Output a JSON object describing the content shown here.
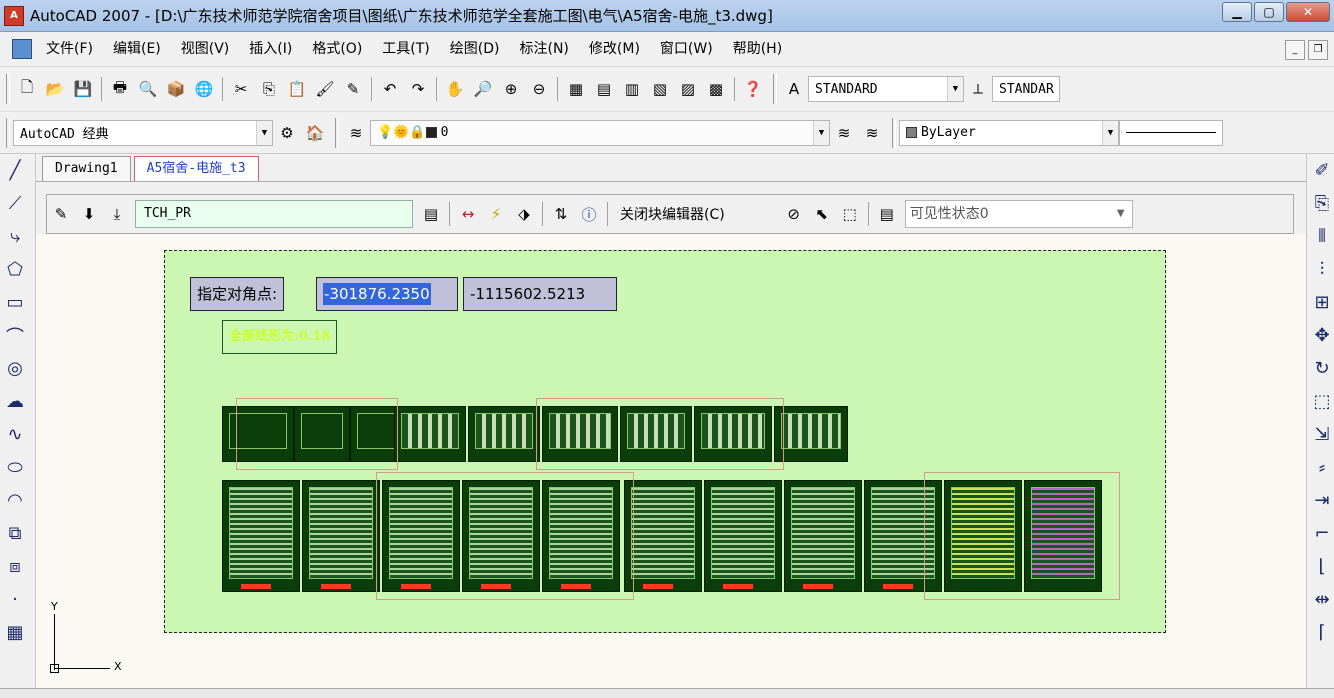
{
  "window": {
    "title": "AutoCAD 2007 - [D:\\广东技术师范学院宿舍项目\\图纸\\广东技术师范学全套施工图\\电气\\A5宿舍-电施_t3.dwg]",
    "app_icon": "autocad-logo-icon",
    "controls": [
      "minimize-icon",
      "maximize-icon",
      "close-icon"
    ]
  },
  "menubar": {
    "items": [
      "文件(F)",
      "编辑(E)",
      "视图(V)",
      "插入(I)",
      "格式(O)",
      "工具(T)",
      "绘图(D)",
      "标注(N)",
      "修改(M)",
      "窗口(W)",
      "帮助(H)"
    ]
  },
  "toolbar_standard": {
    "text_style": "STANDARD",
    "dim_style": "STANDAR"
  },
  "toolbar_layers": {
    "workspace": "AutoCAD 经典",
    "current_layer": "0",
    "color": "ByLayer",
    "color_swatch": "#808080"
  },
  "doc_tabs": [
    {
      "label": "Drawing1",
      "active": false
    },
    {
      "label": "A5宿舍-电施_t3",
      "active": true
    }
  ],
  "block_editor": {
    "block_name": "TCH_PR",
    "close_label": "关闭块编辑器(C)",
    "visibility_placeholder": "可见性状态0"
  },
  "canvas": {
    "prompt_label": "指定对角点:",
    "coord_x": "-301876.2350",
    "coord_y": "-1115602.5213",
    "hint": "全部线形为:0.18",
    "ucs_x": "X",
    "ucs_y": "Y",
    "background": "#ccf7b3"
  },
  "colors": {
    "sheet": "#0b3d0b",
    "selection_highlight": "#3366dd",
    "hint_text": "#c8ff2e",
    "grip_outline": "#d59a8a"
  }
}
